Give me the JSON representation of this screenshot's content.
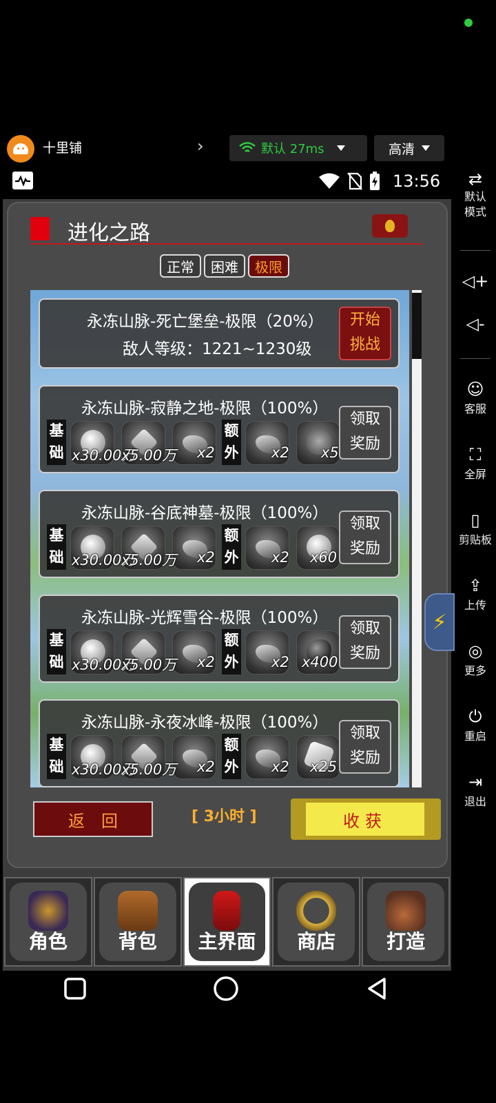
{
  "topbar": {
    "app_name": "十里铺",
    "network_label": "默认 27ms",
    "quality_label": "高清"
  },
  "statusbar": {
    "time": "13:56"
  },
  "sidebar": {
    "items": [
      {
        "label": "默认\n模式",
        "icon": "swap-icon"
      },
      {
        "label": "",
        "icon": "volume-up-icon"
      },
      {
        "label": "",
        "icon": "volume-down-icon"
      },
      {
        "label": "客服",
        "icon": "support-icon"
      },
      {
        "label": "全屏",
        "icon": "fullscreen-icon"
      },
      {
        "label": "剪贴板",
        "icon": "clipboard-icon"
      },
      {
        "label": "上传",
        "icon": "upload-icon"
      },
      {
        "label": "更多",
        "icon": "more-icon"
      },
      {
        "label": "重启",
        "icon": "power-icon"
      },
      {
        "label": "退出",
        "icon": "exit-icon"
      }
    ]
  },
  "panel": {
    "title": "进化之路",
    "tabs": [
      "正常",
      "困难",
      "极限"
    ],
    "active_tab": "极限",
    "current_stage": {
      "title": "永冻山脉-死亡堡垒-极限（20%）",
      "enemy_level": "敌人等级：1221~1230级",
      "button_line1": "开始",
      "button_line2": "挑战"
    },
    "base_tag": [
      "基",
      "础"
    ],
    "extra_tag": [
      "额",
      "外"
    ],
    "claim_line1": "领取",
    "claim_line2": "奖励",
    "stages": [
      {
        "title": "永冻山脉-寂静之地-极限（100%）",
        "q1": "x30.00万",
        "q2": "x5.00万",
        "q3": "x2",
        "q4": "x2",
        "q5": "x5",
        "extra_icon": "lucky-bag-icon"
      },
      {
        "title": "永冻山脉-谷底神墓-极限（100%）",
        "q1": "x30.00万",
        "q2": "x5.00万",
        "q3": "x2",
        "q4": "x2",
        "q5": "x60",
        "extra_icon": "potion-icon"
      },
      {
        "title": "永冻山脉-光辉雪谷-极限（100%）",
        "q1": "x30.00万",
        "q2": "x5.00万",
        "q3": "x2",
        "q4": "x2",
        "q5": "x400",
        "extra_icon": "dark-stone-icon"
      },
      {
        "title": "永冻山脉-永夜冰峰-极限（100%）",
        "q1": "x30.00万",
        "q2": "x5.00万",
        "q3": "x2",
        "q4": "x2",
        "q5": "x25",
        "extra_icon": "white-gem-icon"
      }
    ],
    "back_label": "返回",
    "timer": "[ 3小时 ]",
    "harvest_label": "收获"
  },
  "nav": {
    "tabs": [
      "角色",
      "背包",
      "主界面",
      "商店",
      "打造"
    ],
    "active": "主界面"
  },
  "colors": {
    "accent_red": "#6d0c0c",
    "gold": "#ffb02e",
    "harvest_yellow": "#f3e94a"
  }
}
